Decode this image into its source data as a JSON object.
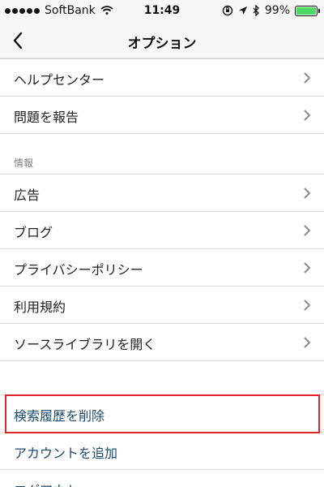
{
  "status_bar": {
    "carrier": "SoftBank",
    "time": "11:49",
    "battery": "99%",
    "battery_level": 0.99
  },
  "nav": {
    "title": "オプション"
  },
  "support_items": [
    {
      "label": "ヘルプセンター"
    },
    {
      "label": "問題を報告"
    }
  ],
  "info_section": {
    "header": "情報",
    "items": [
      {
        "label": "広告"
      },
      {
        "label": "ブログ"
      },
      {
        "label": "プライバシーポリシー"
      },
      {
        "label": "利用規約"
      },
      {
        "label": "ソースライブラリを開く"
      }
    ]
  },
  "account_actions": [
    {
      "label": "検索履歴を削除"
    },
    {
      "label": "アカウントを追加"
    },
    {
      "label": "ログアウト"
    }
  ],
  "colors": {
    "highlight": "#e2232a",
    "action_text": "#1c4a6e",
    "battery": "#4cd964"
  }
}
